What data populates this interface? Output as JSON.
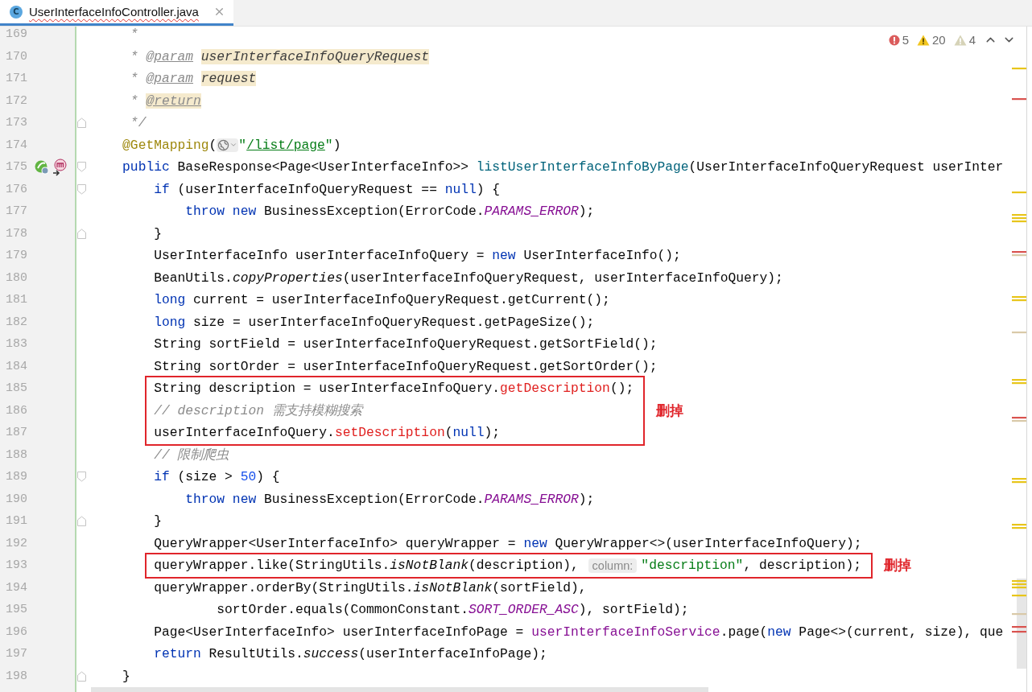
{
  "tab": {
    "letter": "C",
    "title": "UserInterfaceInfoController.java",
    "selected": true,
    "has_errors": true
  },
  "inspections": {
    "errors": "5",
    "warnings": "20",
    "weak_warnings": "4"
  },
  "editor": {
    "blocks": [
      {
        "kind": "line",
        "number": "169",
        "tokens": [
          {
            "kind": "comment",
            "text": "     *"
          }
        ]
      },
      {
        "kind": "line",
        "number": "170",
        "tokens": [
          {
            "kind": "comment",
            "text": "     * "
          },
          {
            "kind": "doc_tag",
            "text": "@param"
          },
          {
            "kind": "doc_ref",
            "text": "userInterfaceInfoQueryRequest"
          }
        ]
      },
      {
        "kind": "line",
        "number": "171",
        "tokens": [
          {
            "kind": "comment",
            "text": "     * "
          },
          {
            "kind": "doc_tag",
            "text": "@param"
          },
          {
            "kind": "doc_ref",
            "text": "request"
          }
        ]
      },
      {
        "kind": "line",
        "number": "172",
        "tokens": [
          {
            "kind": "comment",
            "text": "     * "
          },
          {
            "kind": "doc_tag_ref",
            "text": "@return"
          }
        ]
      },
      {
        "kind": "line",
        "number": "173",
        "gutter_icons": [
          {
            "kind": "fold_end"
          }
        ],
        "tokens": [
          {
            "kind": "comment",
            "text": "     */"
          }
        ]
      },
      {
        "kind": "line",
        "number": "174",
        "tokens": [
          {
            "kind": "annotation",
            "text": "    @GetMapping"
          },
          {
            "kind": "plain",
            "text": "("
          },
          {
            "kind": "endpoint_hint"
          },
          {
            "kind": "string",
            "text": "\""
          },
          {
            "kind": "url",
            "text": "/list/page"
          },
          {
            "kind": "string",
            "text": "\""
          },
          {
            "kind": "plain",
            "text": ")"
          }
        ]
      },
      {
        "kind": "line",
        "number": "175",
        "gutter_icons": [
          {
            "kind": "bean"
          },
          {
            "kind": "mapping"
          },
          {
            "kind": "fold_start"
          }
        ],
        "tokens": [
          {
            "kind": "keyword",
            "text": "    public"
          },
          {
            "kind": "plain",
            "text": " BaseResponse<Page<UserInterfaceInfo>> "
          },
          {
            "kind": "declaration",
            "text": "listUserInterfaceInfoByPage"
          },
          {
            "kind": "plain",
            "text": "(UserInterfaceInfoQueryRequest userInter"
          }
        ]
      },
      {
        "kind": "line",
        "number": "176",
        "gutter_icons": [
          {
            "kind": "fold_start"
          }
        ],
        "tokens": [
          {
            "kind": "keyword",
            "text": "        if"
          },
          {
            "kind": "plain",
            "text": " (userInterfaceInfoQueryRequest == "
          },
          {
            "kind": "keyword",
            "text": "null"
          },
          {
            "kind": "plain",
            "text": ") {"
          }
        ]
      },
      {
        "kind": "line",
        "number": "177",
        "tokens": [
          {
            "kind": "keyword",
            "text": "            throw new"
          },
          {
            "kind": "plain",
            "text": " BusinessException(ErrorCode."
          },
          {
            "kind": "static_field",
            "text": "PARAMS_ERROR"
          },
          {
            "kind": "plain",
            "text": ");"
          }
        ]
      },
      {
        "kind": "line",
        "number": "178",
        "gutter_icons": [
          {
            "kind": "fold_end"
          }
        ],
        "tokens": [
          {
            "kind": "plain",
            "text": "        }"
          }
        ]
      },
      {
        "kind": "line",
        "number": "179",
        "tokens": [
          {
            "kind": "plain",
            "text": "        UserInterfaceInfo userInterfaceInfoQuery = "
          },
          {
            "kind": "keyword",
            "text": "new"
          },
          {
            "kind": "plain",
            "text": " UserInterfaceInfo();"
          }
        ]
      },
      {
        "kind": "line",
        "number": "180",
        "tokens": [
          {
            "kind": "plain",
            "text": "        BeanUtils."
          },
          {
            "kind": "static_method",
            "text": "copyProperties"
          },
          {
            "kind": "plain",
            "text": "(userInterfaceInfoQueryRequest, userInterfaceInfoQuery);"
          }
        ]
      },
      {
        "kind": "line",
        "number": "181",
        "tokens": [
          {
            "kind": "keyword",
            "text": "        long"
          },
          {
            "kind": "plain",
            "text": " current = userInterfaceInfoQueryRequest.getCurrent();"
          }
        ]
      },
      {
        "kind": "line",
        "number": "182",
        "tokens": [
          {
            "kind": "keyword",
            "text": "        long"
          },
          {
            "kind": "plain",
            "text": " size = userInterfaceInfoQueryRequest.getPageSize();"
          }
        ]
      },
      {
        "kind": "line",
        "number": "183",
        "tokens": [
          {
            "kind": "plain",
            "text": "        String sortField = userInterfaceInfoQueryRequest.getSortField();"
          }
        ]
      },
      {
        "kind": "line",
        "number": "184",
        "tokens": [
          {
            "kind": "plain",
            "text": "        String sortOrder = userInterfaceInfoQueryRequest.getSortOrder();"
          }
        ]
      },
      {
        "kind": "boxed",
        "note": "删掉",
        "lines": [
          {
            "number": "185",
            "tokens": [
              {
                "kind": "plain",
                "text": "        String description = userInterfaceInfoQuery."
              },
              {
                "kind": "error",
                "text": "getDescription"
              },
              {
                "kind": "plain",
                "text": "();"
              }
            ]
          },
          {
            "number": "186",
            "tokens": [
              {
                "kind": "comment",
                "text": "        // description 需支持模糊搜索"
              }
            ]
          },
          {
            "number": "187",
            "tokens": [
              {
                "kind": "plain",
                "text": "        userInterfaceInfoQuery."
              },
              {
                "kind": "error",
                "text": "setDescription"
              },
              {
                "kind": "plain",
                "text": "("
              },
              {
                "kind": "keyword",
                "text": "null"
              },
              {
                "kind": "plain",
                "text": ");"
              }
            ]
          }
        ]
      },
      {
        "kind": "line",
        "number": "188",
        "tokens": [
          {
            "kind": "comment",
            "text": "        // 限制爬虫"
          }
        ]
      },
      {
        "kind": "line",
        "number": "189",
        "gutter_icons": [
          {
            "kind": "fold_start"
          }
        ],
        "tokens": [
          {
            "kind": "keyword",
            "text": "        if"
          },
          {
            "kind": "plain",
            "text": " (size > "
          },
          {
            "kind": "number",
            "text": "50"
          },
          {
            "kind": "plain",
            "text": ") {"
          }
        ]
      },
      {
        "kind": "line",
        "number": "190",
        "tokens": [
          {
            "kind": "keyword",
            "text": "            throw new"
          },
          {
            "kind": "plain",
            "text": " BusinessException(ErrorCode."
          },
          {
            "kind": "static_field",
            "text": "PARAMS_ERROR"
          },
          {
            "kind": "plain",
            "text": ");"
          }
        ]
      },
      {
        "kind": "line",
        "number": "191",
        "gutter_icons": [
          {
            "kind": "fold_end"
          }
        ],
        "tokens": [
          {
            "kind": "plain",
            "text": "        }"
          }
        ]
      },
      {
        "kind": "line",
        "number": "192",
        "tokens": [
          {
            "kind": "plain",
            "text": "        QueryWrapper<UserInterfaceInfo> queryWrapper = "
          },
          {
            "kind": "keyword",
            "text": "new"
          },
          {
            "kind": "plain",
            "text": " QueryWrapper<>(userInterfaceInfoQuery);"
          }
        ]
      },
      {
        "kind": "boxed",
        "note": "删掉",
        "lines": [
          {
            "number": "193",
            "tokens": [
              {
                "kind": "plain",
                "text": "        queryWrapper.like(StringUtils."
              },
              {
                "kind": "static_method",
                "text": "isNotBlank"
              },
              {
                "kind": "plain",
                "text": "(description), "
              },
              {
                "kind": "param_hint",
                "text": "column:"
              },
              {
                "kind": "string",
                "text": "\"description\""
              },
              {
                "kind": "plain",
                "text": ", description);"
              }
            ]
          }
        ]
      },
      {
        "kind": "line",
        "number": "194",
        "tokens": [
          {
            "kind": "plain",
            "text": "        queryWrapper.orderBy(StringUtils."
          },
          {
            "kind": "static_method",
            "text": "isNotBlank"
          },
          {
            "kind": "plain",
            "text": "(sortField),"
          }
        ]
      },
      {
        "kind": "line",
        "number": "195",
        "tokens": [
          {
            "kind": "plain",
            "text": "                sortOrder.equals(CommonConstant."
          },
          {
            "kind": "static_field",
            "text": "SORT_ORDER_ASC"
          },
          {
            "kind": "plain",
            "text": "), sortField);"
          }
        ]
      },
      {
        "kind": "line",
        "number": "196",
        "tokens": [
          {
            "kind": "plain",
            "text": "        Page<UserInterfaceInfo> userInterfaceInfoPage = "
          },
          {
            "kind": "field",
            "text": "userInterfaceInfoService"
          },
          {
            "kind": "plain",
            "text": ".page("
          },
          {
            "kind": "keyword",
            "text": "new"
          },
          {
            "kind": "plain",
            "text": " Page<>(current, size), que"
          }
        ]
      },
      {
        "kind": "line",
        "number": "197",
        "tokens": [
          {
            "kind": "keyword",
            "text": "        return"
          },
          {
            "kind": "plain",
            "text": " ResultUtils."
          },
          {
            "kind": "static_method",
            "text": "success"
          },
          {
            "kind": "plain",
            "text": "(userInterfaceInfoPage);"
          }
        ]
      },
      {
        "kind": "line",
        "number": "198",
        "gutter_icons": [
          {
            "kind": "fold_end"
          }
        ],
        "tokens": [
          {
            "kind": "plain",
            "text": "    }"
          }
        ]
      }
    ]
  }
}
